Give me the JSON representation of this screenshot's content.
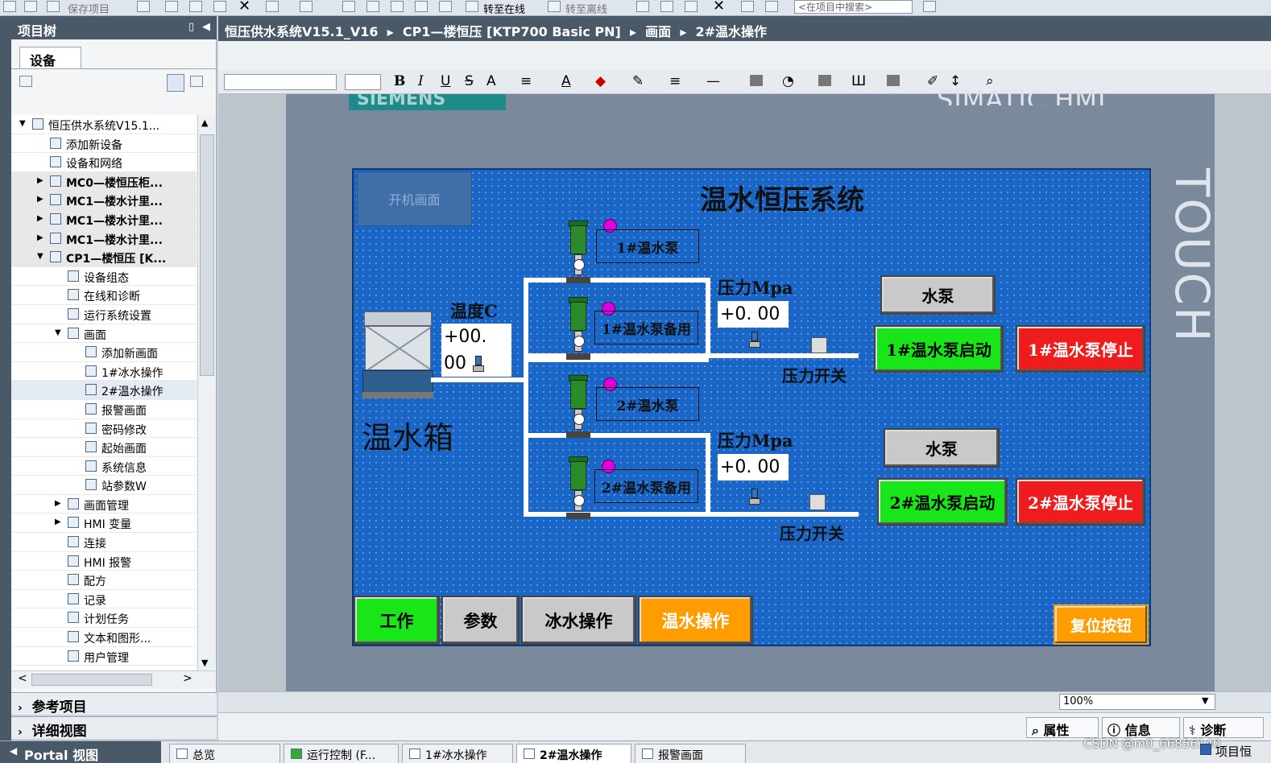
{
  "toolbar": {
    "save_project": "保存项目",
    "go_online": "转至在线",
    "go_offline": "转至离线",
    "search_placeholder": "<在项目中搜索>"
  },
  "project_tree": {
    "title": "项目树",
    "tab": "设备",
    "items": [
      {
        "label": "恒压供水系统V15.1...",
        "indent": 0,
        "arrow": "▼"
      },
      {
        "label": "添加新设备",
        "indent": 1,
        "arrow": ""
      },
      {
        "label": "设备和网络",
        "indent": 1,
        "arrow": ""
      },
      {
        "label": "MC0—楼恒压柜...",
        "indent": 1,
        "arrow": "▶",
        "group": true
      },
      {
        "label": "MC1—楼水计里...",
        "indent": 1,
        "arrow": "▶",
        "group": true
      },
      {
        "label": "MC1—楼水计里...",
        "indent": 1,
        "arrow": "▶",
        "group": true
      },
      {
        "label": "MC1—楼水计里...",
        "indent": 1,
        "arrow": "▶",
        "group": true
      },
      {
        "label": "CP1—楼恒压 [K...",
        "indent": 1,
        "arrow": "▼",
        "group": true
      },
      {
        "label": "设备组态",
        "indent": 2,
        "arrow": ""
      },
      {
        "label": "在线和诊断",
        "indent": 2,
        "arrow": ""
      },
      {
        "label": "运行系统设置",
        "indent": 2,
        "arrow": ""
      },
      {
        "label": "画面",
        "indent": 2,
        "arrow": "▼"
      },
      {
        "label": "添加新画面",
        "indent": 3,
        "arrow": ""
      },
      {
        "label": "1#冰水操作",
        "indent": 3,
        "arrow": ""
      },
      {
        "label": "2#温水操作",
        "indent": 3,
        "arrow": "",
        "selected": true
      },
      {
        "label": "报警画面",
        "indent": 3,
        "arrow": ""
      },
      {
        "label": "密码修改",
        "indent": 3,
        "arrow": ""
      },
      {
        "label": "起始画面",
        "indent": 3,
        "arrow": ""
      },
      {
        "label": "系统信息",
        "indent": 3,
        "arrow": ""
      },
      {
        "label": "站参数W",
        "indent": 3,
        "arrow": ""
      },
      {
        "label": "画面管理",
        "indent": 2,
        "arrow": "▶"
      },
      {
        "label": "HMI 变量",
        "indent": 2,
        "arrow": "▶"
      },
      {
        "label": "连接",
        "indent": 2,
        "arrow": ""
      },
      {
        "label": "HMI 报警",
        "indent": 2,
        "arrow": ""
      },
      {
        "label": "配方",
        "indent": 2,
        "arrow": ""
      },
      {
        "label": "记录",
        "indent": 2,
        "arrow": ""
      },
      {
        "label": "计划任务",
        "indent": 2,
        "arrow": ""
      },
      {
        "label": "文本和图形...",
        "indent": 2,
        "arrow": ""
      },
      {
        "label": "用户管理",
        "indent": 2,
        "arrow": ""
      }
    ],
    "reference_projects": "参考项目",
    "details_view": "详细视图"
  },
  "breadcrumb": {
    "project": "恒压供水系统V15.1_V16",
    "device": "CP1—楼恒压 [KTP700 Basic PN]",
    "screens": "画面",
    "current": "2#温水操作"
  },
  "hmi_panel": {
    "brand": "SIEMENS",
    "model": "SIMATIC HMI",
    "touch": "TOUCH"
  },
  "hmi": {
    "title": "温水恒压系统",
    "boot_screen": "开机画面",
    "tank_label": "温水箱",
    "temp_label": "温度C",
    "temp_value": "+00. 00",
    "pressure_label_1": "压力Mpa",
    "pressure_value_1": "+0. 00",
    "pressure_label_2": "压力Mpa",
    "pressure_value_2": "+0. 00",
    "pressure_switch_1": "压力开关",
    "pressure_switch_2": "压力开关",
    "pump1": "1#温水泵",
    "pump1_backup": "1#温水泵备用",
    "pump2": "2#温水泵",
    "pump2_backup": "2#温水泵备用",
    "water_pump_1": "水泵",
    "water_pump_2": "水泵",
    "pump1_start": "1#温水泵启动",
    "pump1_stop": "1#温水泵停止",
    "pump2_start": "2#温水泵启动",
    "pump2_stop": "2#温水泵停止",
    "nav_work": "工作",
    "nav_params": "参数",
    "nav_ice": "冰水操作",
    "nav_warm": "温水操作",
    "reset": "复位按钮"
  },
  "zoom": "100%",
  "inspector_tabs": {
    "properties": "属性",
    "info": "信息",
    "diagnostics": "诊断"
  },
  "taskbar": {
    "portal_view": "Portal 视图",
    "tasks": [
      "总览",
      "运行控制 (F...",
      "1#冰水操作",
      "2#温水操作",
      "报警画面"
    ],
    "active_task": "2#温水操作",
    "watermark": "CSDN @m0_66856140",
    "project_label": "项目恒"
  },
  "colors": {
    "screen_bg": "#1a66c7",
    "start_green": "#19e619",
    "stop_red": "#ee1c1c",
    "warm_orange": "#ff9c00",
    "led_magenta": "#e000e0"
  }
}
